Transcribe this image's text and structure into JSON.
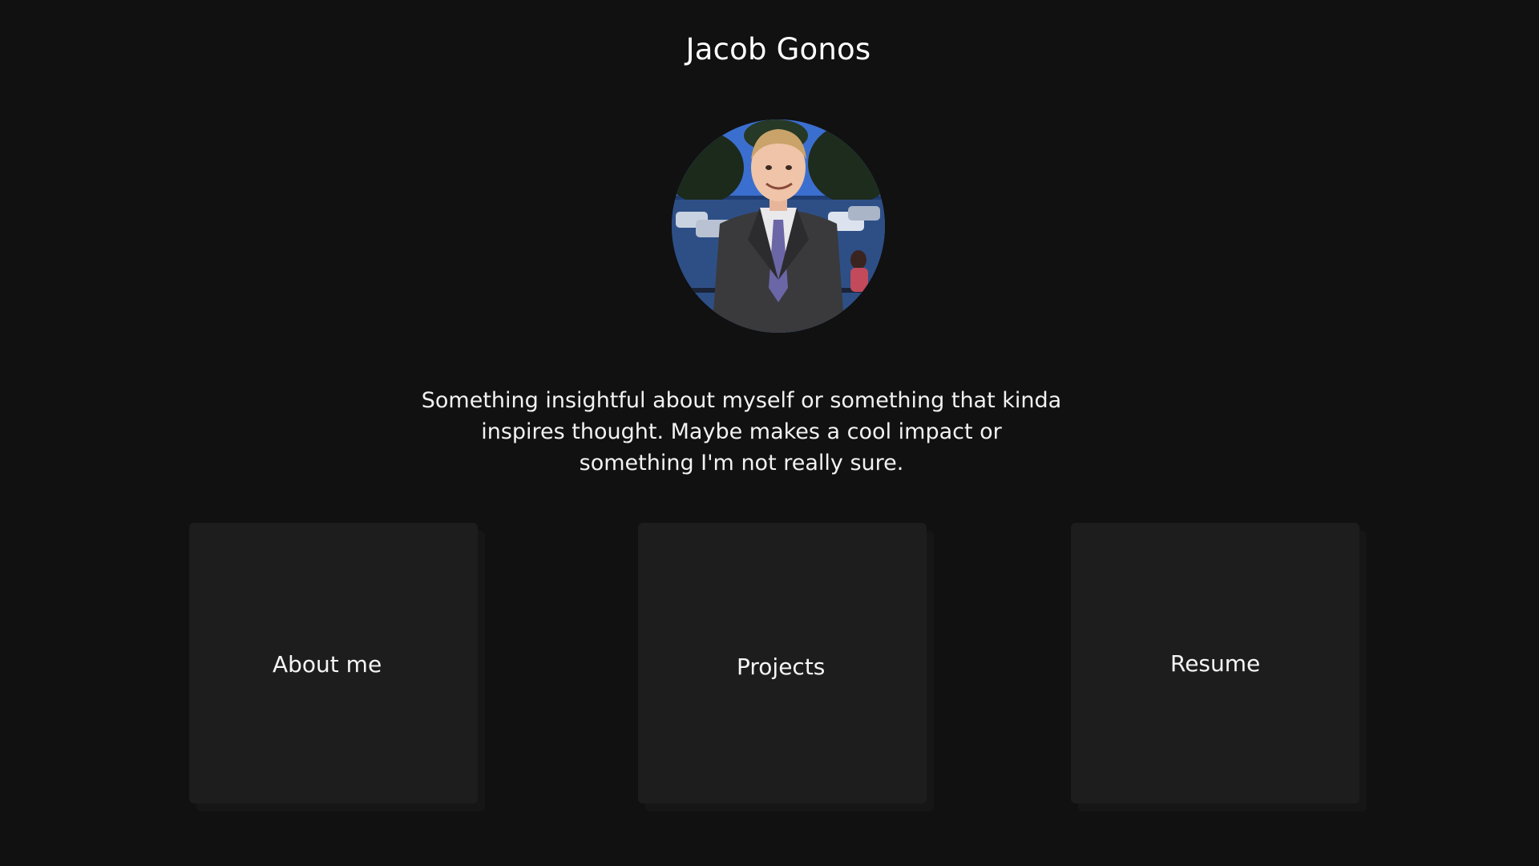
{
  "header": {
    "title": "Jacob Gonos"
  },
  "profile": {
    "photo_description": "avatar-photo"
  },
  "bio": {
    "text": "Something insightful about myself or something that kinda inspires thought. Maybe makes a cool impact or something I'm not really sure."
  },
  "nav": {
    "cards": [
      {
        "label": "About me"
      },
      {
        "label": "Projects"
      },
      {
        "label": "Resume"
      }
    ]
  },
  "colors": {
    "background": "#111111",
    "card": "#1d1d1d",
    "text": "#ffffff"
  }
}
